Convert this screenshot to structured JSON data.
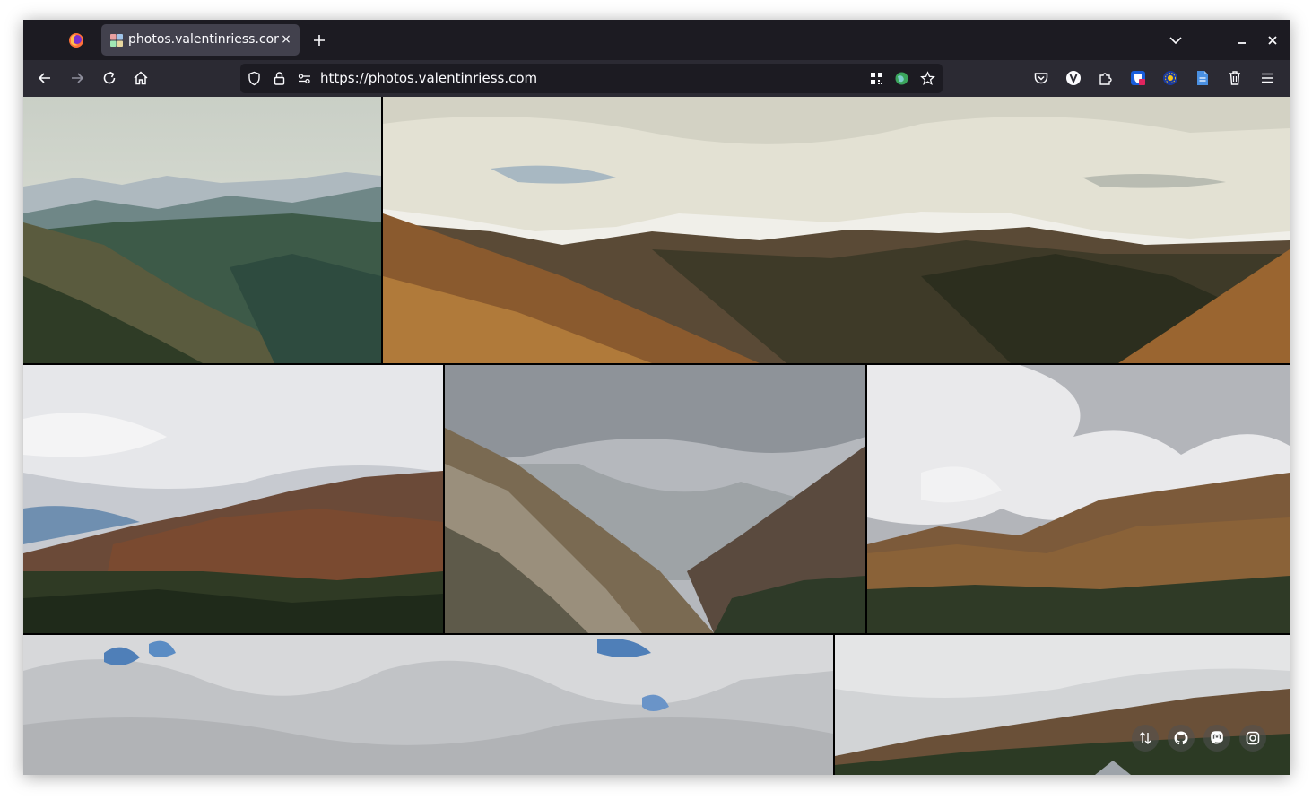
{
  "browser": {
    "tab_title": "photos.valentinriess.com/",
    "tab_close_glyph": "×",
    "url": "https://photos.valentinriess.com"
  },
  "icons": [
    "firefox-logo",
    "favicon",
    "close-icon",
    "plus-icon",
    "chevron-down-icon",
    "minimize-icon",
    "close-window-icon",
    "back-arrow-icon",
    "forward-arrow-icon",
    "reload-icon",
    "home-icon",
    "shield-icon",
    "lock-icon",
    "permissions-icon",
    "qr-code-icon",
    "globe-icon",
    "star-icon",
    "pocket-icon",
    "v-extension-icon",
    "extensions-icon",
    "bitwarden-icon",
    "extension-blue-icon",
    "document-icon",
    "trash-icon",
    "menu-icon",
    "sort-arrows-icon",
    "github-icon",
    "mastodon-icon",
    "instagram-icon"
  ],
  "colors": {
    "tabbar": "#1c1b22",
    "toolbar": "#2b2a33",
    "tab_active": "#42414d",
    "urlbar": "#1c1b22",
    "text": "#fbfbfe"
  }
}
